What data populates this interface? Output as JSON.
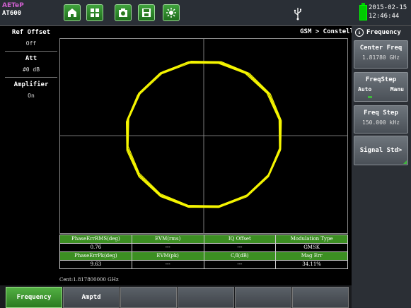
{
  "brand": {
    "line1": "AETeP",
    "line2": "AT600"
  },
  "toolbar": {
    "icons": [
      "home-icon",
      "fullscreen-icon",
      "camera-icon",
      "save-icon",
      "brightness-icon"
    ]
  },
  "status": {
    "date": "2015-02-15",
    "time": "12:46:44",
    "usb_icon": "usb-icon",
    "battery_icon": "battery-icon"
  },
  "left_panel": {
    "ref_offset_title": "Ref Offset",
    "ref_offset_value": "Off",
    "att_title": "Att",
    "att_value": "#0 dB",
    "amplifier_title": "Amplifier",
    "amplifier_value": "On"
  },
  "plot": {
    "header": "GSM > Constell",
    "trace_color": "#f5f500",
    "grid_color": "#9a9a9a"
  },
  "results": {
    "headers_row1": [
      "PhaseErrRMS(deg)",
      "EVM(rms)",
      "IQ Offset",
      "Modulation Type"
    ],
    "values_row1": [
      "0.76",
      "---",
      "---",
      "GMSK"
    ],
    "headers_row2": [
      "PhaseErrPk(deg)",
      "EVM(pk)",
      "C/I(dB)",
      "Mag Err"
    ],
    "values_row2": [
      "9.63",
      "---",
      "---",
      "34.11%"
    ],
    "center": "Cent:1.817800000 GHz"
  },
  "right_panel": {
    "title": "Frequency",
    "center_freq_label": "Center Freq",
    "center_freq_value": "1.81780 GHz",
    "freqstep_label": "FreqStep",
    "freqstep_auto": "Auto",
    "freqstep_manu": "Manu",
    "freq_step_label": "Freq Step",
    "freq_step_value": "150.000 kHz",
    "signal_std_label": "Signal Std>"
  },
  "bottom_tabs": [
    "Frequency",
    "Amptd",
    "",
    "",
    "",
    ""
  ],
  "colors": {
    "accent_green": "#3c8f22",
    "active_tab": "#2c7a20"
  }
}
